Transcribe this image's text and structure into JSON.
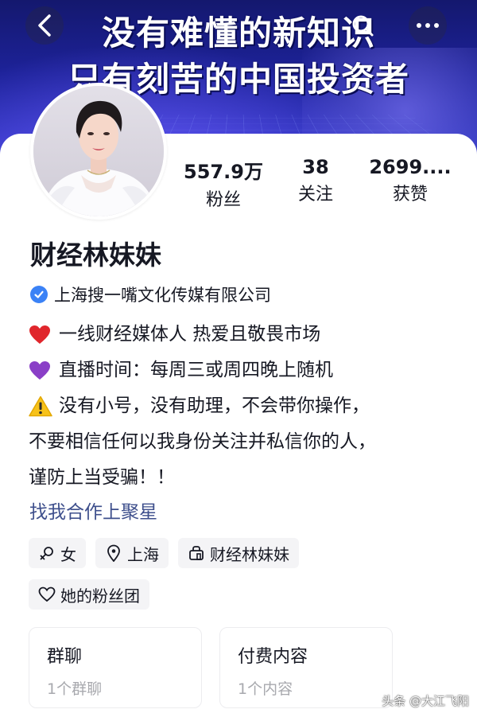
{
  "banner": {
    "line1": "没有难懂的新知识",
    "line2": "只有刻苦的中国投资者"
  },
  "nav": {
    "back_icon": "back-arrow-icon",
    "search_icon": "search-icon",
    "more_icon": "more-dots-icon"
  },
  "profile": {
    "name": "财经林妹妹",
    "verification": "上海搜一嘴文化传媒有限公司",
    "stats": [
      {
        "value": "557.9万",
        "label": "粉丝"
      },
      {
        "value": "38",
        "label": "关注"
      },
      {
        "value": "2699....",
        "label": "获赞"
      }
    ],
    "bio": [
      {
        "emoji": "red-heart",
        "text": " 一线财经媒体人  热爱且敬畏市场"
      },
      {
        "emoji": "purple-heart",
        "text": "直播时间：每周三或周四晚上随机"
      },
      {
        "emoji": "warning",
        "text": " 没有小号，没有助理，不会带你操作，"
      },
      {
        "emoji": "",
        "text": "不要相信任何以我身份关注并私信你的人，"
      },
      {
        "emoji": "",
        "text": "谨防上当受骗！！"
      }
    ],
    "cooperation_link": "找我合作上聚星",
    "tags": [
      {
        "icon": "female-icon",
        "label": "女"
      },
      {
        "icon": "location-icon",
        "label": "上海"
      },
      {
        "icon": "shop-icon",
        "label": "财经林妹妹"
      }
    ],
    "fan_group": {
      "icon": "heart-outline-icon",
      "label": "她的粉丝团"
    },
    "cards": [
      {
        "title": "群聊",
        "sub": "1个群聊"
      },
      {
        "title": "付费内容",
        "sub": "1个内容"
      }
    ]
  },
  "watermark": "头条 @大江飞阳",
  "colors": {
    "banner_dark": "#14186e",
    "banner_light": "#3036c4",
    "verify_blue": "#3b82f6",
    "link_blue": "#3e4f8c",
    "muted_text": "#a8a9ae",
    "tag_bg": "#f4f4f6"
  }
}
